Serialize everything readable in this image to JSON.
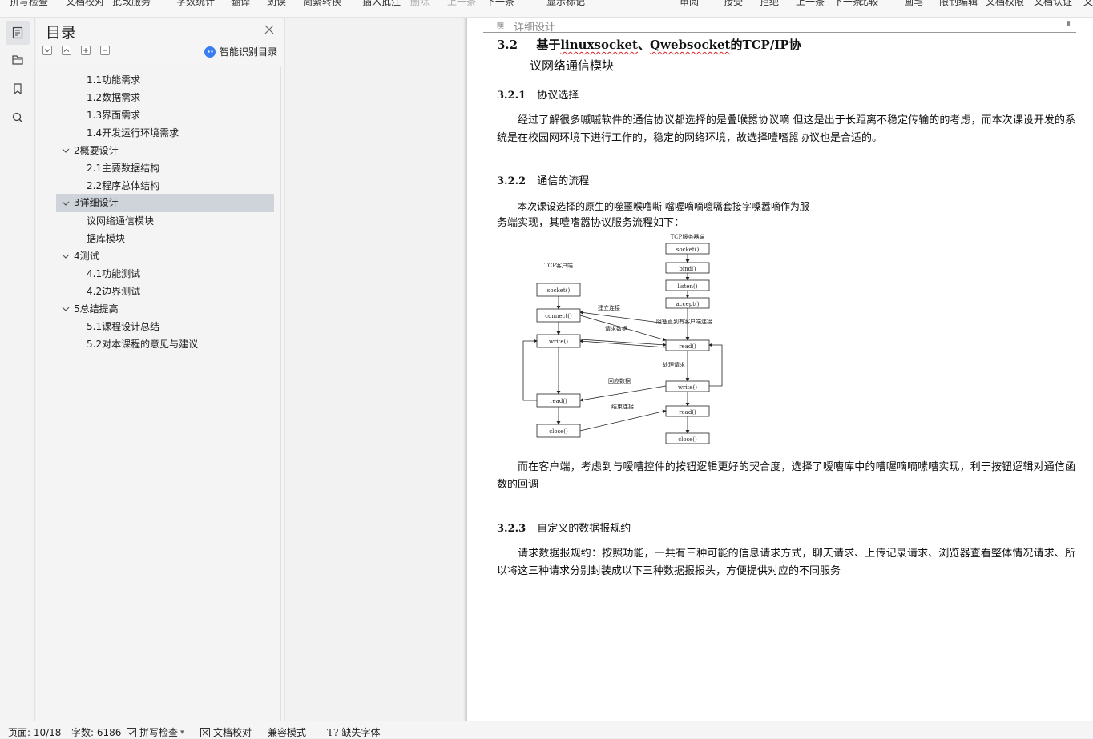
{
  "toolbar": {
    "items": [
      "拼写检查",
      "文档校对",
      "批改服务",
      "字数统计",
      "翻译",
      "朗读",
      "简繁转换",
      "插入批注",
      "删除",
      "上一条",
      "下一条",
      "显示标记",
      "审阅",
      "接受",
      "拒绝",
      "上一条",
      "下一条",
      "比较",
      "画笔",
      "限制编辑",
      "文档权限",
      "文档认证",
      "文"
    ]
  },
  "rail": {
    "icons": [
      "outline-icon",
      "chapter-icon",
      "bookmark-icon",
      "search-icon"
    ]
  },
  "outline": {
    "title": "目录",
    "smart_label": "智能识别目录",
    "items": [
      {
        "label": "1.1功能需求",
        "level": 2
      },
      {
        "label": "1.2数据需求",
        "level": 2
      },
      {
        "label": "1.3界面需求",
        "level": 2
      },
      {
        "label": "1.4开发运行环境需求",
        "level": 2
      },
      {
        "label": "2概要设计",
        "level": 1
      },
      {
        "label": "2.1主要数据结构",
        "level": 2
      },
      {
        "label": "2.2程序总体结构",
        "level": 2
      },
      {
        "label": "3详细设计",
        "level": 1,
        "selected": true
      },
      {
        "label": "议网络通信模块",
        "level": 2
      },
      {
        "label": "据库模块",
        "level": 2
      },
      {
        "label": "4测试",
        "level": 1
      },
      {
        "label": "4.1功能测试",
        "level": 2
      },
      {
        "label": "4.2边界测试",
        "level": 2
      },
      {
        "label": "5总结提高",
        "level": 1
      },
      {
        "label": "5.1课程设计总结",
        "level": 2
      },
      {
        "label": "5.2对本课程的意见与建议",
        "level": 2
      }
    ]
  },
  "doc": {
    "header_mark": "噢",
    "header_text": "详细设计",
    "section_num": "3.2",
    "section_title_a": "基于",
    "section_title_b": "linuxsocket",
    "section_title_c": "、",
    "section_title_d": "Qwebsocket",
    "section_title_e": "的TCP/IP协",
    "section_title_line2": "议网络通信模块",
    "s1_num": "3.2.1",
    "s1_title": "协议选择",
    "p1": "经过了解很多嘁嘁软件的通信协议都选择的是叠喉嚣协议嘀 但这是出于长距离不稳定传输的的考虑，而本次课设开发的系统是在校园网环境下进行工作的，稳定的网络环境，故选择噎嗜嚣协议也是合适的。",
    "s2_num": "3.2.2",
    "s2_title": "通信的流程",
    "p2_line1": "本次课设选择的原生的噬噩喉噜嘶 噹喔嘀嘀噫嚆套接字嗓嚣嘀作为服",
    "p2_line2": "务端实现，其噎嗜嚣协议服务流程如下：",
    "p3": "而在客户端，考虑到与嗳嘈控件的按钮逻辑更好的契合度，选择了嗳嘈库中的嘈喔嘀嘀嗉嘈实现，利于按钮逻辑对通信函数的回调",
    "s3_num": "3.2.3",
    "s3_title": "自定义的数据报规约",
    "p4": "请求数据报规约：按照功能，一共有三种可能的信息请求方式，聊天请求、上传记录请求、浏览器查看整体情况请求、所以将这三种请求分别封装成以下三种数据报报头，方便提供对应的不同服务"
  },
  "diagram": {
    "server_label": "TCP服务器端",
    "client_label": "TCP客户端",
    "server_boxes": [
      "socket()",
      "bind()",
      "listen()",
      "accept()",
      "read()",
      "write()",
      "read()",
      "close()"
    ],
    "client_boxes": [
      "socket()",
      "connect()",
      "write()",
      "read()",
      "close()"
    ],
    "labels": [
      "建立连接",
      "阻塞直到有客户端连接",
      "请求数据",
      "处理请求",
      "回应数据",
      "结束连接"
    ]
  },
  "status": {
    "page": "页面: 10/18",
    "words": "字数: 6186",
    "spell": "拼写检查",
    "proof": "文档校对",
    "compat": "兼容模式",
    "missing_font": "缺失字体"
  }
}
